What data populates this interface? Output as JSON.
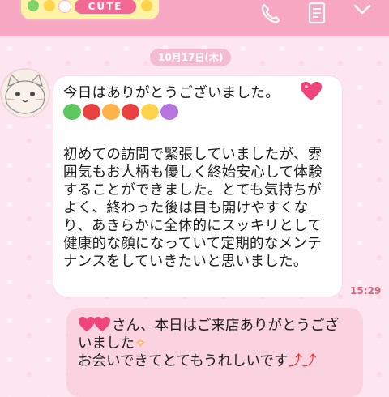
{
  "header": {
    "theme_badge": "CUTE",
    "call_icon": "phone-icon",
    "notes_icon": "notes-icon",
    "menu_icon": "chevron-down-icon",
    "color": "#f7a7c2"
  },
  "chat": {
    "date": "10月17日(木)",
    "incoming": {
      "first_line": "今日はありがとうございました。",
      "body": "初めての訪問で緊張していましたが、雰囲気もお人柄も優しく終始安心して体験することができました。とても気持ちがよく、終わった後は目も開けやすくなり、あきらかに全体的にスッキリとして健康的な顔になっていて定期的なメンテナンスをしていきたいと思いました。",
      "time": "15:29"
    },
    "outgoing": {
      "line1": "さん、本日はご来店ありがとうございました",
      "line2": "お会いできてとてもうれしいです"
    }
  }
}
